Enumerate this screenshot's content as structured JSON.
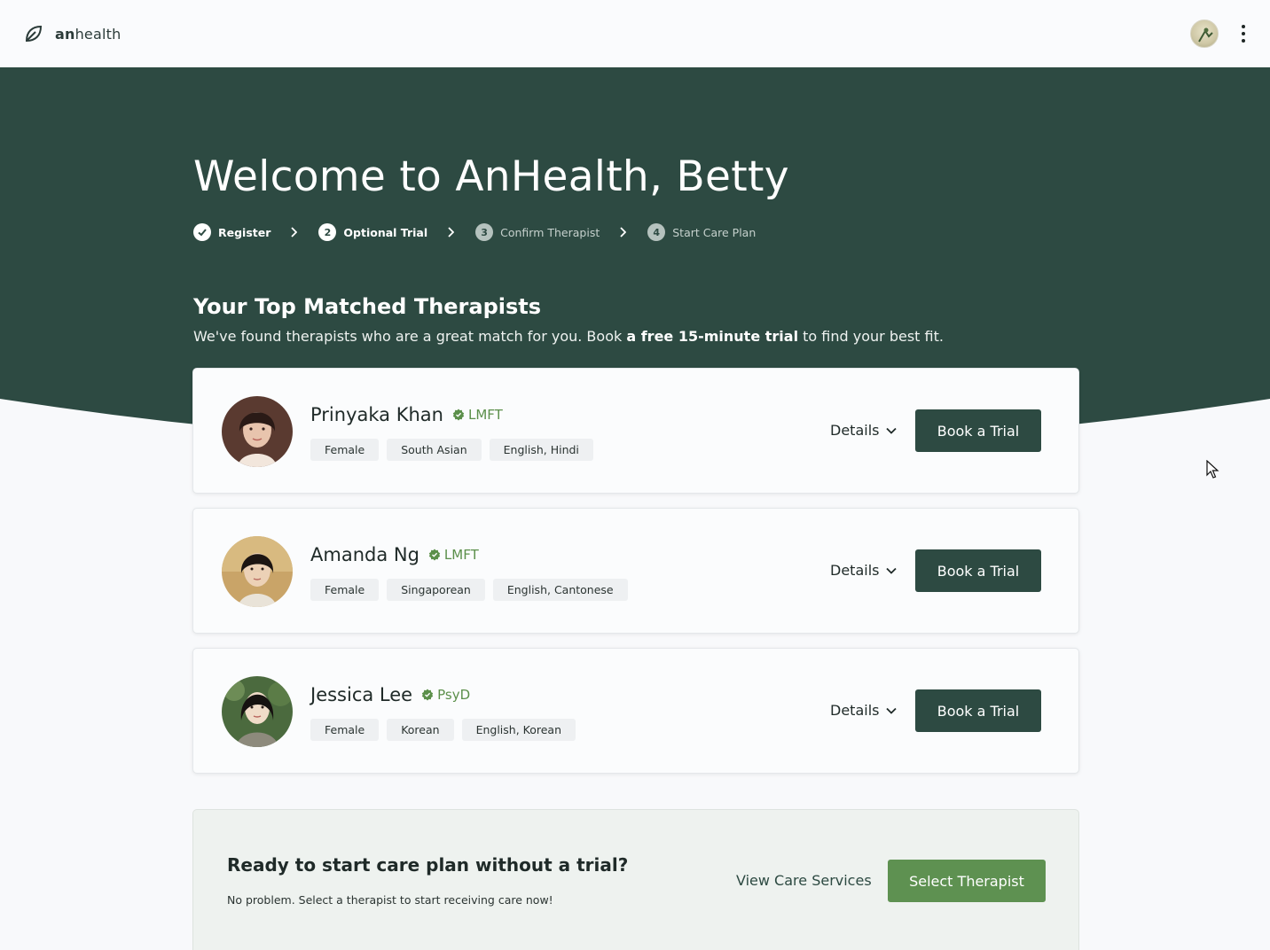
{
  "app": {
    "brand_bold": "an",
    "brand_rest": "health"
  },
  "hero": {
    "welcome": "Welcome to AnHealth, Betty",
    "steps": [
      {
        "number": "",
        "label": "Register",
        "state": "done"
      },
      {
        "number": "2",
        "label": "Optional Trial",
        "state": "current"
      },
      {
        "number": "3",
        "label": "Confirm Therapist",
        "state": "upcoming"
      },
      {
        "number": "4",
        "label": "Start Care Plan",
        "state": "upcoming"
      }
    ],
    "section_title": "Your Top Matched Therapists",
    "section_sub_before": "We've found therapists who are a great match for you. Book ",
    "section_sub_bold": "a free 15-minute trial",
    "section_sub_after": " to find your best fit."
  },
  "therapists": [
    {
      "name": "Prinyaka Khan",
      "credential": "LMFT",
      "tags": [
        "Female",
        "South Asian",
        "English, Hindi"
      ],
      "details_label": "Details",
      "book_label": "Book a Trial"
    },
    {
      "name": "Amanda Ng",
      "credential": "LMFT",
      "tags": [
        "Female",
        "Singaporean",
        "English, Cantonese"
      ],
      "details_label": "Details",
      "book_label": "Book a Trial"
    },
    {
      "name": "Jessica Lee",
      "credential": "PsyD",
      "tags": [
        "Female",
        "Korean",
        "English, Korean"
      ],
      "details_label": "Details",
      "book_label": "Book a Trial"
    }
  ],
  "cta": {
    "title": "Ready to start care plan without a trial?",
    "subtitle": "No problem. Select a therapist to start receiving care now!",
    "link_label": "View Care Services",
    "button_label": "Select Therapist"
  },
  "colors": {
    "brand_dark": "#2d4a42",
    "accent_green": "#5e9151",
    "credential_green": "#5b8f4a"
  }
}
